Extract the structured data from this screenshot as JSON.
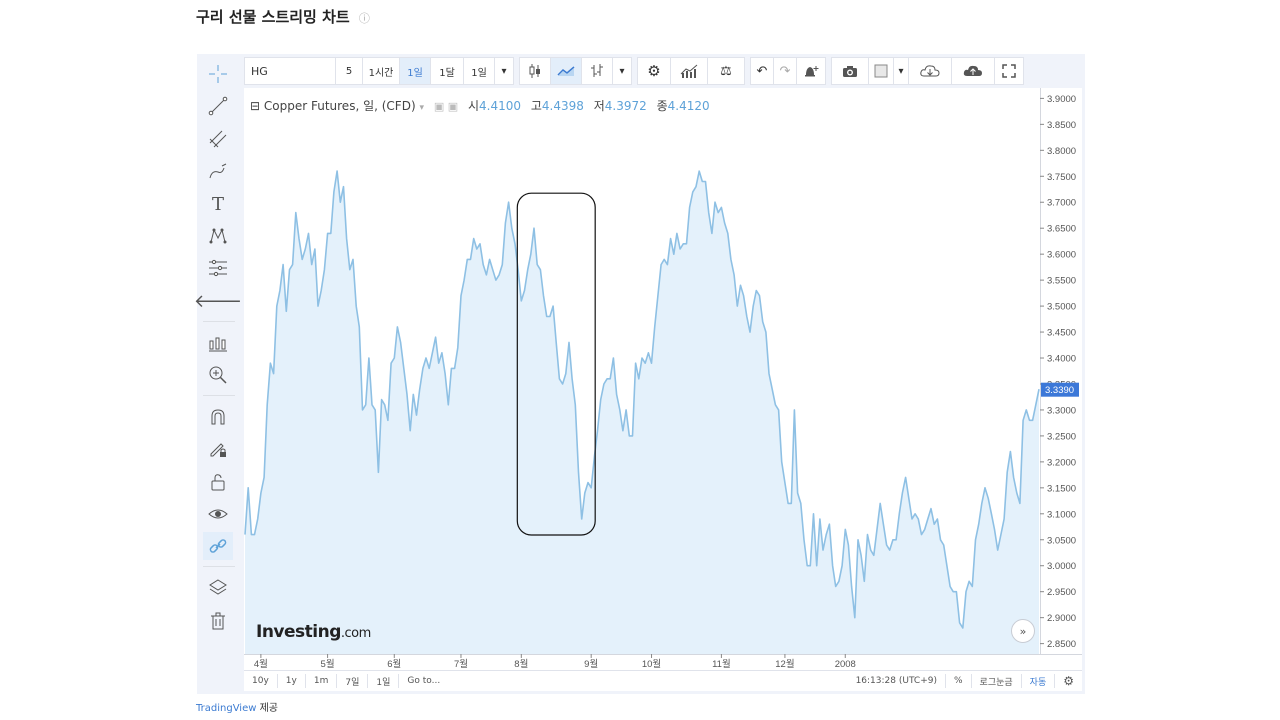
{
  "page": {
    "title": "구리 선물 스트리밍 차트",
    "info_icon": "ⓘ"
  },
  "toolbar": {
    "symbol": "HG",
    "interval_5": "5",
    "interval_1h": "1시간",
    "interval_1d": "1일",
    "interval_1m": "1달",
    "interval_sel": "1일",
    "dropdown_caret": "▾",
    "icons": [
      "candles-icon",
      "area-chart-icon",
      "bars-icon",
      "gear-icon",
      "indicators-icon",
      "compare-icon",
      "undo-icon",
      "redo-icon",
      "alert-icon",
      "camera-icon",
      "color-square-icon",
      "cloud-download-icon",
      "cloud-upload-icon",
      "fullscreen-icon"
    ]
  },
  "legend": {
    "collapse": "⊟",
    "title": "Copper Futures, 일, (CFD)",
    "caret": "▾",
    "o_label": "시",
    "o_value": "4.4100",
    "h_label": "고",
    "h_value": "4.4398",
    "l_label": "저",
    "l_value": "4.3972",
    "c_label": "종",
    "c_value": "4.4120"
  },
  "logo": {
    "main": "Investing",
    "suffix": ".com"
  },
  "scroll_button": "»",
  "bottombar": {
    "ranges": [
      "10y",
      "1y",
      "1m",
      "7일",
      "1일",
      "Go to..."
    ],
    "time": "16:13:28 (UTC+9)",
    "percent": "%",
    "log": "로그눈금",
    "auto": "자동"
  },
  "credit": {
    "link": "TradingView",
    "suffix": " 제공"
  },
  "colors": {
    "line": "#8ec0e4",
    "fill": "#e4f1fb",
    "price_tag": "#3c78d8",
    "accent": "#3c7bd1"
  },
  "chart_data": {
    "type": "area",
    "title": "",
    "xlabel": "",
    "ylabel": "",
    "current_price": "3.3390",
    "ylim": [
      2.83,
      3.92
    ],
    "y_ticks": [
      "3.9000",
      "3.8500",
      "3.8000",
      "3.7500",
      "3.7000",
      "3.6500",
      "3.6000",
      "3.5500",
      "3.5000",
      "3.4500",
      "3.4000",
      "3.3500",
      "3.3000",
      "3.2500",
      "3.2000",
      "3.1500",
      "3.1000",
      "3.0500",
      "3.0000",
      "2.9500",
      "2.9000",
      "2.8500"
    ],
    "x_ticks": [
      {
        "label": "4월",
        "i": 5
      },
      {
        "label": "5월",
        "i": 26
      },
      {
        "label": "6월",
        "i": 47
      },
      {
        "label": "7월",
        "i": 68
      },
      {
        "label": "8월",
        "i": 87
      },
      {
        "label": "9월",
        "i": 109
      },
      {
        "label": "10월",
        "i": 128
      },
      {
        "label": "11월",
        "i": 150
      },
      {
        "label": "12월",
        "i": 170
      },
      {
        "label": "2008",
        "i": 189
      }
    ],
    "values": [
      3.06,
      3.15,
      3.06,
      3.06,
      3.09,
      3.14,
      3.17,
      3.31,
      3.39,
      3.37,
      3.5,
      3.53,
      3.58,
      3.49,
      3.57,
      3.58,
      3.68,
      3.63,
      3.59,
      3.61,
      3.64,
      3.58,
      3.61,
      3.5,
      3.53,
      3.57,
      3.64,
      3.64,
      3.72,
      3.76,
      3.7,
      3.73,
      3.63,
      3.57,
      3.59,
      3.5,
      3.46,
      3.3,
      3.31,
      3.4,
      3.31,
      3.3,
      3.18,
      3.32,
      3.31,
      3.28,
      3.39,
      3.4,
      3.46,
      3.43,
      3.38,
      3.33,
      3.26,
      3.33,
      3.29,
      3.34,
      3.38,
      3.4,
      3.38,
      3.41,
      3.44,
      3.39,
      3.41,
      3.37,
      3.31,
      3.38,
      3.38,
      3.42,
      3.52,
      3.55,
      3.59,
      3.59,
      3.63,
      3.61,
      3.62,
      3.58,
      3.56,
      3.59,
      3.57,
      3.55,
      3.56,
      3.58,
      3.66,
      3.7,
      3.65,
      3.62,
      3.57,
      3.51,
      3.53,
      3.57,
      3.6,
      3.65,
      3.58,
      3.57,
      3.52,
      3.48,
      3.48,
      3.5,
      3.43,
      3.36,
      3.35,
      3.37,
      3.43,
      3.36,
      3.31,
      3.18,
      3.09,
      3.14,
      3.16,
      3.15,
      3.21,
      3.26,
      3.32,
      3.35,
      3.36,
      3.36,
      3.4,
      3.33,
      3.3,
      3.26,
      3.3,
      3.25,
      3.25,
      3.39,
      3.36,
      3.4,
      3.39,
      3.41,
      3.39,
      3.46,
      3.52,
      3.58,
      3.59,
      3.58,
      3.63,
      3.6,
      3.64,
      3.61,
      3.62,
      3.62,
      3.69,
      3.72,
      3.73,
      3.76,
      3.74,
      3.74,
      3.68,
      3.64,
      3.7,
      3.68,
      3.69,
      3.66,
      3.64,
      3.59,
      3.56,
      3.5,
      3.54,
      3.52,
      3.48,
      3.45,
      3.5,
      3.53,
      3.52,
      3.47,
      3.45,
      3.37,
      3.34,
      3.31,
      3.3,
      3.2,
      3.16,
      3.12,
      3.12,
      3.3,
      3.14,
      3.12,
      3.05,
      3.0,
      3.0,
      3.1,
      3.0,
      3.09,
      3.03,
      3.06,
      3.08,
      3.0,
      2.96,
      2.97,
      3.0,
      3.07,
      3.04,
      2.96,
      2.9,
      3.05,
      3.02,
      2.97,
      3.06,
      3.03,
      3.02,
      3.07,
      3.12,
      3.08,
      3.04,
      3.03,
      3.05,
      3.05,
      3.1,
      3.14,
      3.17,
      3.13,
      3.09,
      3.1,
      3.09,
      3.06,
      3.07,
      3.09,
      3.11,
      3.08,
      3.09,
      3.05,
      3.04,
      3.0,
      2.96,
      2.95,
      2.95,
      2.89,
      2.88,
      2.95,
      2.97,
      2.96,
      3.05,
      3.08,
      3.12,
      3.15,
      3.13,
      3.1,
      3.07,
      3.03,
      3.06,
      3.09,
      3.18,
      3.22,
      3.17,
      3.14,
      3.12,
      3.28,
      3.3,
      3.28,
      3.28,
      3.31,
      3.34
    ],
    "highlight_box": {
      "from_i": 87,
      "to_i": 109
    }
  }
}
